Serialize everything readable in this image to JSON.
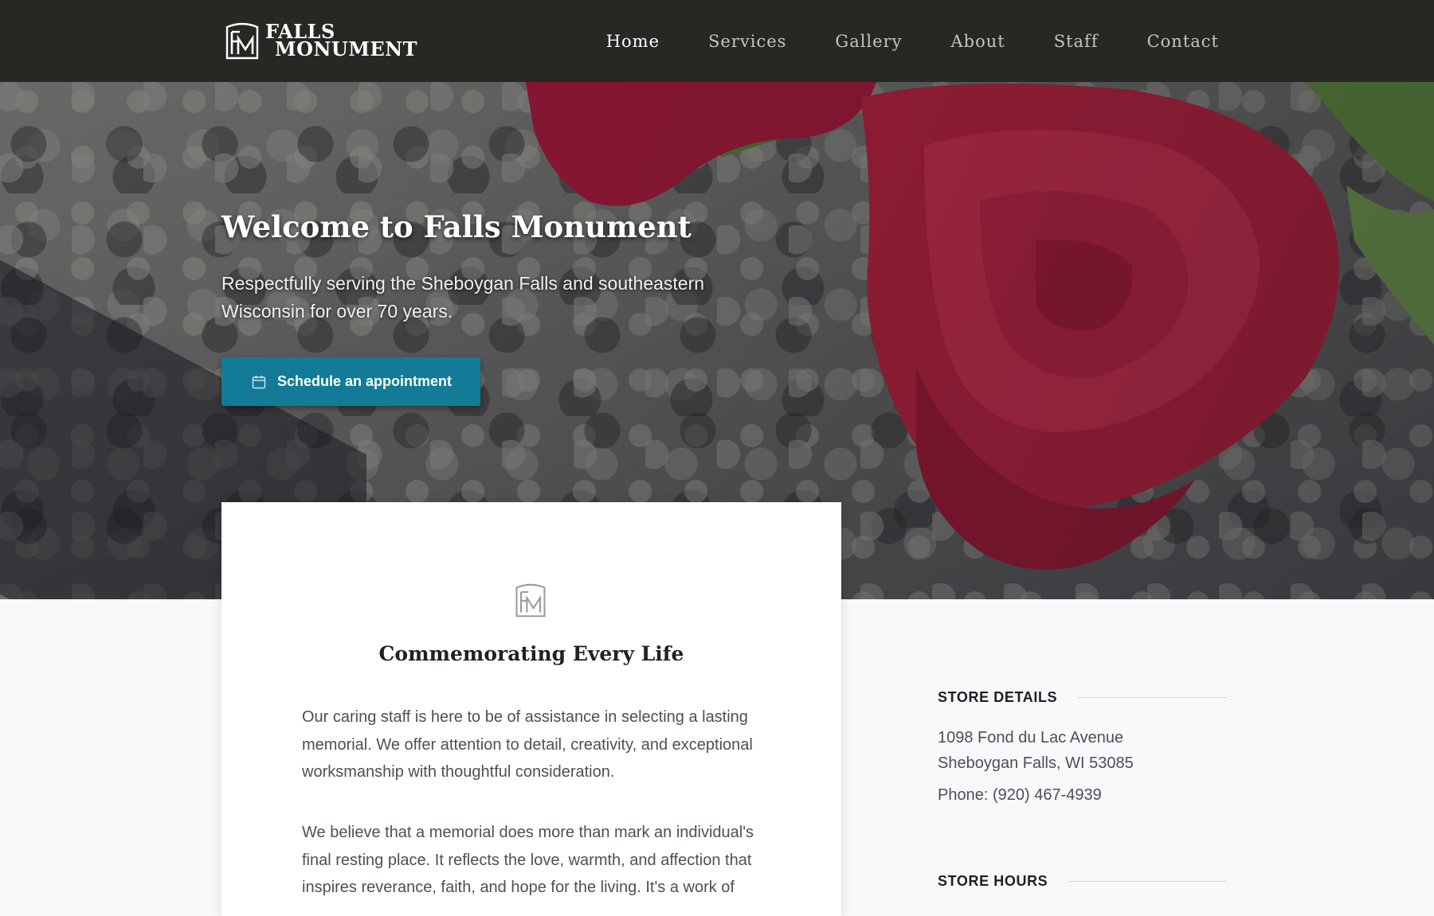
{
  "brand": {
    "logo_monogram": "FM",
    "logo_line1": "FALLS",
    "logo_line2": "MONUMENT"
  },
  "nav": {
    "items": [
      {
        "label": "Home",
        "active": true
      },
      {
        "label": "Services",
        "active": false
      },
      {
        "label": "Gallery",
        "active": false
      },
      {
        "label": "About",
        "active": false
      },
      {
        "label": "Staff",
        "active": false
      },
      {
        "label": "Contact",
        "active": false
      }
    ]
  },
  "hero": {
    "title": "Welcome to Falls Monument",
    "subtitle": "Respectfully serving the Sheboygan Falls and southeastern Wisconsin for over 70 years.",
    "cta_label": "Schedule an appointment",
    "cta_icon": "calendar-icon",
    "background_image": "red-rose-on-granite"
  },
  "intro_card": {
    "emblem": "FM",
    "title": "Commemorating Every Life",
    "paragraph1": "Our caring staff is here to be of assistance in selecting a lasting memorial. We offer attention to detail, creativity, and exceptional worksmanship with thoughtful consideration.",
    "paragraph2": "We believe that a memorial does more than mark an individual's final resting place. It reflects the love, warmth, and affection that inspires reverance, faith, and hope for the living. It's a work of"
  },
  "sidebar": {
    "store_details_heading": "STORE DETAILS",
    "address_line1": "1098 Fond du Lac Avenue",
    "address_line2": "Sheboygan Falls, WI 53085",
    "phone": "Phone: (920) 467-4939",
    "store_hours_heading": "STORE HOURS"
  },
  "colors": {
    "nav_background": "#272724",
    "accent": "#137b97",
    "page_background": "#f7f9fb",
    "rose": "#b51e3c"
  }
}
